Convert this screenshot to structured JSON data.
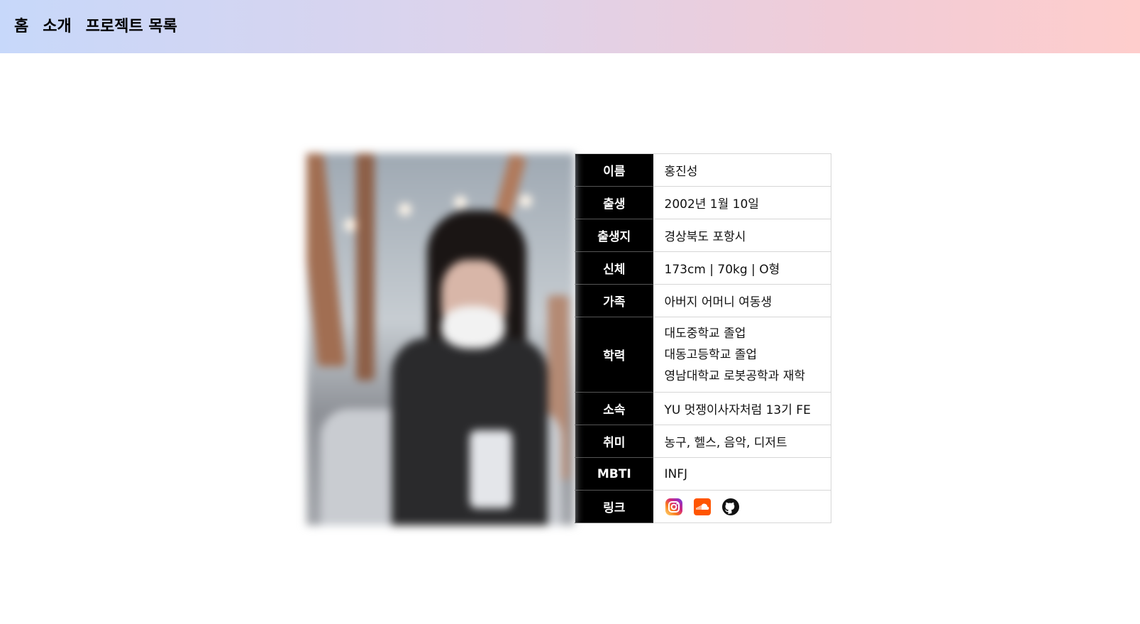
{
  "nav": {
    "items": [
      {
        "label": "홈"
      },
      {
        "label": "소개"
      },
      {
        "label": "프로젝트 목록"
      }
    ]
  },
  "profile": {
    "rows": {
      "name": {
        "label": "이름",
        "value": "홍진성"
      },
      "birth": {
        "label": "출생",
        "value": "2002년 1월 10일"
      },
      "birthplace": {
        "label": "출생지",
        "value": "경상북도 포항시"
      },
      "body": {
        "label": "신체",
        "value": "173cm | 70kg | O형"
      },
      "family": {
        "label": "가족",
        "value": "아버지 어머니 여동생"
      },
      "education": {
        "label": "학력",
        "values": [
          "대도중학교 졸업",
          "대동고등학교 졸업",
          "영남대학교 로봇공학과 재학"
        ]
      },
      "affiliation": {
        "label": "소속",
        "value": "YU 멋쟁이사자처럼 13기 FE"
      },
      "hobby": {
        "label": "취미",
        "value": "농구, 헬스, 음악, 디저트"
      },
      "mbti": {
        "label": "MBTI",
        "value": "INFJ"
      },
      "links": {
        "label": "링크",
        "icons": [
          "instagram-icon",
          "soundcloud-icon",
          "github-icon"
        ]
      }
    }
  },
  "colors": {
    "nav_gradient_start": "#c7d8fa",
    "nav_gradient_end": "#fecdcc",
    "header_cell_bg": "#000000",
    "soundcloud": "#ff5500"
  }
}
